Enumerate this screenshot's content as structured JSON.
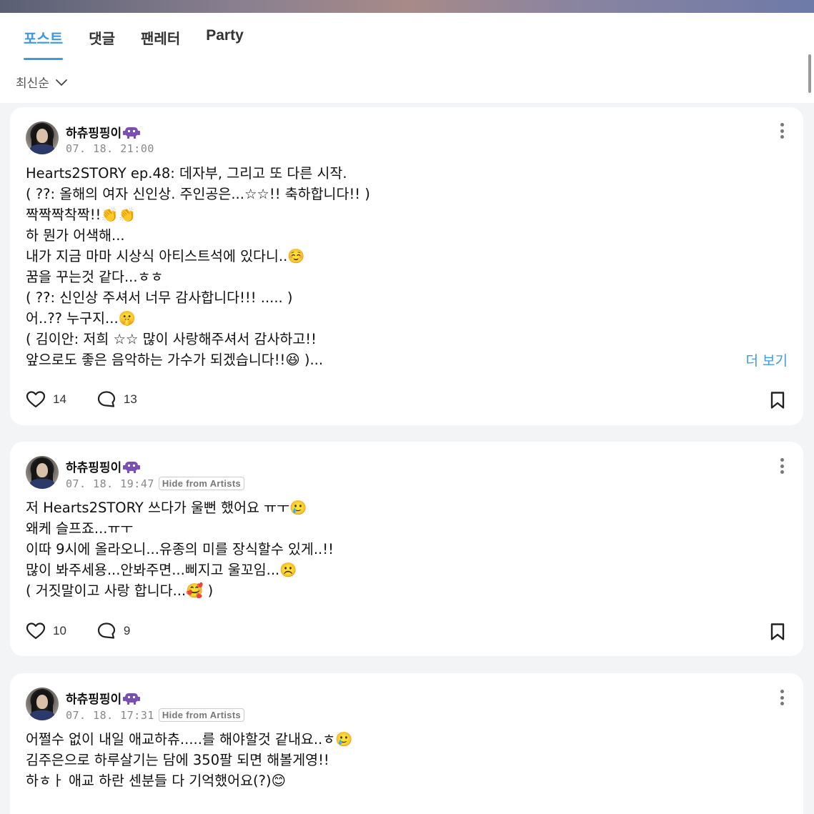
{
  "tabs": [
    {
      "label": "포스트",
      "active": true
    },
    {
      "label": "댓글",
      "active": false
    },
    {
      "label": "팬레터",
      "active": false
    },
    {
      "label": "Party",
      "active": false
    }
  ],
  "sort": {
    "label": "최신순"
  },
  "colors": {
    "accent": "#3b9ae1",
    "card_bg": "#ffffff",
    "page_bg": "#f3f4f6"
  },
  "posts": [
    {
      "author": "하츄핑핑이",
      "author_icon": "alien-monster-icon",
      "timestamp": "07. 18. 21:00",
      "badge": "",
      "body": "Hearts2STORY   ep.48: 데자부, 그리고 또 다른 시작.\n( ??: 올해의 여자 신인상. 주인공은...☆☆!! 축하합니다!! )\n짝짝짝착짝!!👏👏\n하 뭔가 어색해...\n내가 지금 마마 시상식 아티스트석에 있다니..☺️\n꿈을 꾸는것 같다...ㅎㅎ\n( ??: 신인상 주셔서 너무 감사합니다!!! ..... )\n어..?? 누구지...🤫\n( 김이안: 저희 ☆☆ 많이 사랑해주셔서 감사하고!!\n앞으로도 좋은 음악하는 가수가 되겠습니다!!😆 )...",
      "see_more": "더 보기",
      "likes": "14",
      "comments": "13"
    },
    {
      "author": "하츄핑핑이",
      "author_icon": "alien-monster-icon",
      "timestamp": "07. 18. 19:47",
      "badge": "Hide from Artists",
      "body": "저 Hearts2STORY 쓰다가 울뻔 했어요 ㅠㅜ🥲\n왜케 슬프죠...ㅠㅜ\n이따 9시에 올라오니...유종의 미를 장식할수 있게..!!\n많이 봐주세용...안봐주면...삐지고 울꼬임...☹️\n( 거짓말이고 사랑 합니다...🥰 )",
      "see_more": "",
      "likes": "10",
      "comments": "9"
    },
    {
      "author": "하츄핑핑이",
      "author_icon": "alien-monster-icon",
      "timestamp": "07. 18. 17:31",
      "badge": "Hide from Artists",
      "body": "어쩔수 없이 내일 애교하츄.....를 해야할것 같내요..ㅎ🥲\n김주은으로 하루살기는 담에 350팔 되면 해볼게영!!\n하ㅎㅏ 애교 하란 센분들 다 기억했어요(?)😊",
      "see_more": "",
      "likes": "",
      "comments": ""
    }
  ]
}
